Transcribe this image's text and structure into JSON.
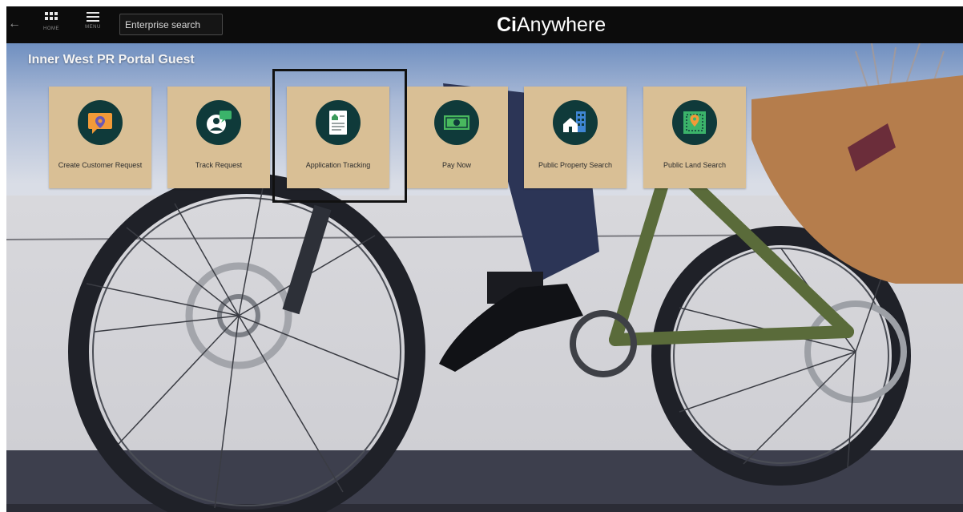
{
  "topbar": {
    "back_glyph": "←",
    "home_caption": "HOME",
    "menu_caption": "MENU",
    "search_label": "Enterprise search",
    "brand_prefix": "Ci",
    "brand_suffix": "Anywhere",
    "icons": {
      "back": "back-arrow-icon",
      "home": "grid-icon",
      "menu": "hamburger-icon"
    }
  },
  "portal": {
    "title": "Inner West PR Portal Guest"
  },
  "tiles": [
    {
      "label": "Create Customer Request",
      "icon": "location-chat-icon"
    },
    {
      "label": "Track Request",
      "icon": "person-chat-icon"
    },
    {
      "label": "Application Tracking",
      "icon": "document-house-icon"
    },
    {
      "label": "Pay Now",
      "icon": "banknote-icon"
    },
    {
      "label": "Public Property Search",
      "icon": "house-building-icon"
    },
    {
      "label": "Public Land Search",
      "icon": "map-pin-icon"
    }
  ],
  "colors": {
    "topbar": "#0c0c0c",
    "tile": "#d9bf95",
    "icon_circle": "#0f3a3a",
    "highlight_border": "#111111"
  }
}
